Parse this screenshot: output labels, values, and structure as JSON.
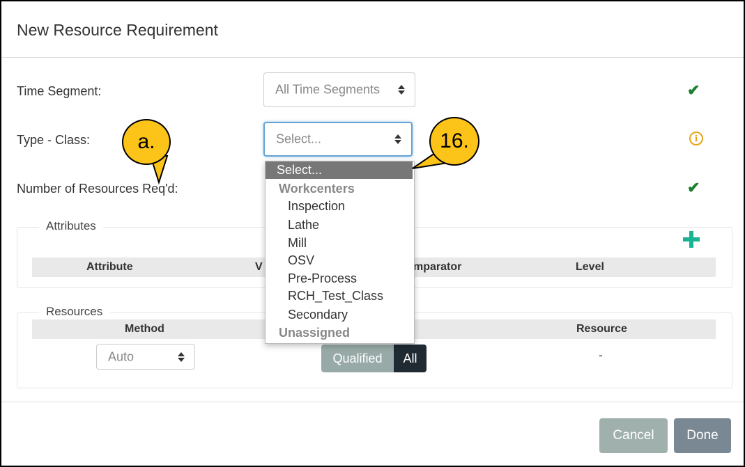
{
  "dialog": {
    "title": "New Resource Requirement"
  },
  "form": {
    "time_segment_label": "Time Segment:",
    "time_segment_value": "All Time Segments",
    "type_class_label": "Type - Class:",
    "type_class_value": "Select...",
    "num_resources_label": "Number of Resources Req'd:"
  },
  "attributes": {
    "legend": "Attributes",
    "headers": [
      "Attribute",
      "V",
      "mparator",
      "Level"
    ]
  },
  "resources": {
    "legend": "Resources",
    "headers": [
      "Method",
      "Resource"
    ],
    "method_value": "Auto",
    "toggle": [
      "Qualified",
      "All"
    ],
    "resource_value": "-"
  },
  "dropdown": {
    "selected": "Select...",
    "groups": [
      {
        "label": "Workcenters",
        "items": [
          "Inspection",
          "Lathe",
          "Mill",
          "OSV",
          "Pre-Process",
          "RCH_Test_Class",
          "Secondary"
        ]
      },
      {
        "label": "Unassigned",
        "items": []
      }
    ]
  },
  "footer": {
    "cancel": "Cancel",
    "done": "Done"
  },
  "callouts": {
    "a": "a.",
    "b": "16."
  },
  "colors": {
    "check": "#1a7f2e",
    "info": "#e8a317",
    "plus": "#1ab394",
    "callout": "#fcc419",
    "done_bg": "#7a8893",
    "cancel_bg": "#9fb0ad"
  }
}
